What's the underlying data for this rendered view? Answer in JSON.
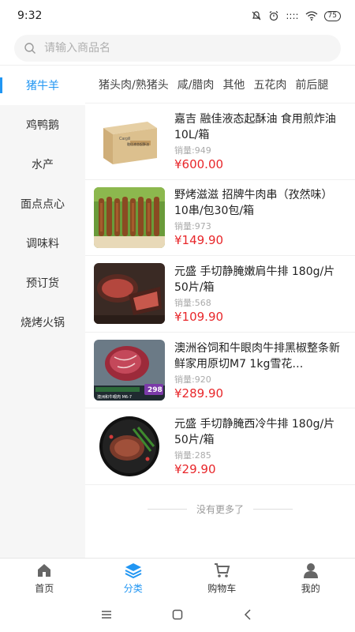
{
  "status": {
    "time": "9:32",
    "signal": "::::",
    "battery": "75"
  },
  "search": {
    "placeholder": "请输入商品名"
  },
  "sidebar": {
    "items": [
      {
        "label": "猪牛羊"
      },
      {
        "label": "鸡鸭鹅"
      },
      {
        "label": "水产"
      },
      {
        "label": "面点点心"
      },
      {
        "label": "调味料"
      },
      {
        "label": "预订货"
      },
      {
        "label": "烧烤火锅"
      }
    ]
  },
  "subcategories": [
    "猪头肉/熟猪头",
    "咸/腊肉",
    "其他",
    "五花肉",
    "前后腿"
  ],
  "products": [
    {
      "name": "嘉吉 融佳液态起酥油 食用煎炸油 10L/箱",
      "sold": "销量:949",
      "price": "¥600.00"
    },
    {
      "name": "野烤滋滋 招牌牛肉串（孜然味）10串/包30包/箱",
      "sold": "销量:973",
      "price": "¥149.90"
    },
    {
      "name": "元盛 手切静腌嫩肩牛排 180g/片 50片/箱",
      "sold": "销量:568",
      "price": "¥109.90"
    },
    {
      "name": "澳洲谷饲和牛眼肉牛排黑椒整条新鲜家用原切M7 1kg雪花…",
      "sold": "销量:920",
      "price": "¥289.90"
    },
    {
      "name": "元盛 手切静腌西冷牛排 180g/片 50片/箱",
      "sold": "销量:285",
      "price": "¥29.90"
    }
  ],
  "product_images": {
    "box_label": "融佳液态起酥油",
    "box_brand": "Cargill",
    "sticker_price": "298",
    "sticker_caption": "澳洲和牛眼肉  M6-7"
  },
  "list_end": "没有更多了",
  "tabbar": {
    "items": [
      {
        "label": "首页",
        "icon": "home-icon"
      },
      {
        "label": "分类",
        "icon": "category-icon"
      },
      {
        "label": "购物车",
        "icon": "cart-icon"
      },
      {
        "label": "我的",
        "icon": "user-icon"
      }
    ]
  },
  "colors": {
    "accent": "#2196f3",
    "price": "#e8272b",
    "sidebar_bg": "#f6f6f6"
  }
}
